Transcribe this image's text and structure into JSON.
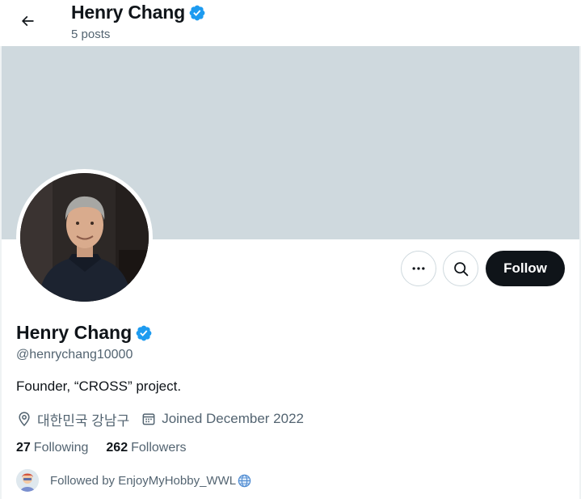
{
  "header": {
    "name": "Henry Chang",
    "posts": "5 posts"
  },
  "profile": {
    "name": "Henry Chang",
    "handle": "@henrychang10000",
    "bio": "Founder, “CROSS” project.",
    "location": "대한민국 강남구",
    "joined": "Joined December 2022",
    "following_count": "27",
    "following_label": "Following",
    "followers_count": "262",
    "followers_label": "Followers",
    "followed_by": "Followed by EnjoyMyHobby_WWL"
  },
  "actions": {
    "follow_label": "Follow"
  },
  "icons": {
    "back": "back-arrow-icon",
    "verified": "verified-badge-icon",
    "more": "more-icon",
    "search": "search-icon",
    "location": "location-pin-icon",
    "calendar": "calendar-icon",
    "globe": "globe-icon"
  },
  "colors": {
    "banner": "#cfd9de",
    "verified": "#1d9bf0",
    "follow_bg": "#0f1419",
    "secondary_text": "#536471"
  }
}
